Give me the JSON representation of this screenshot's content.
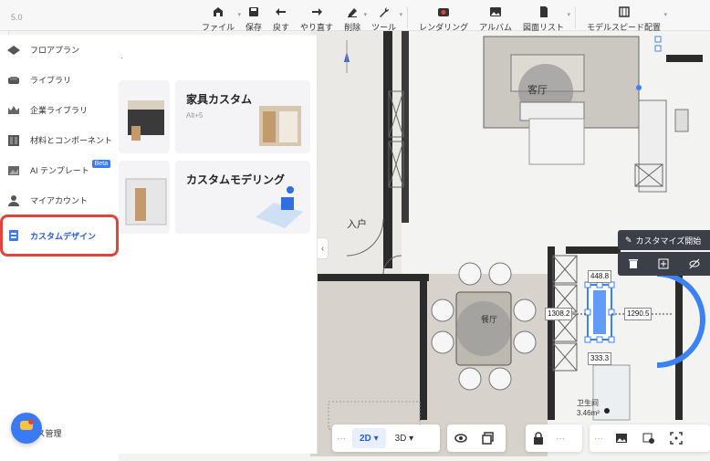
{
  "toolbar": {
    "file": "ファイル",
    "save": "保存",
    "undo": "戻す",
    "redo": "やり直す",
    "delete": "削除",
    "tools": "ツール",
    "render": "レンダリング",
    "album": "アルバム",
    "drawing_list": "図面リスト",
    "model_speed": "モデルスピード配置"
  },
  "ruler": {
    "top_value": "5.0"
  },
  "side_menu": {
    "items": [
      {
        "label": "フロアプラン",
        "icon": "floorplan-icon"
      },
      {
        "label": "ライブラリ",
        "icon": "sofa-icon"
      },
      {
        "label": "企業ライブラリ",
        "icon": "crown-icon"
      },
      {
        "label": "材料とコンポーネント",
        "icon": "materials-icon"
      },
      {
        "label": "AI テンプレート",
        "icon": "ai-template-icon",
        "badge": "Beta"
      },
      {
        "label": "マイアカウント",
        "icon": "user-icon"
      },
      {
        "label": "カスタムデザイン",
        "icon": "custom-design-icon",
        "active": true
      }
    ],
    "bottom_label": "ース管理"
  },
  "panel": {
    "hint": ".",
    "cards": [
      {
        "title": "",
        "subtitle": ""
      },
      {
        "title": "家具カスタム",
        "subtitle": "Alt+5"
      },
      {
        "title": "",
        "subtitle": ""
      },
      {
        "title": "カスタムモデリング",
        "subtitle": ""
      }
    ]
  },
  "plan": {
    "living_room": "客厅",
    "entrance": "入户",
    "dining_room": "餐厅",
    "bathroom": "卫生间",
    "bathroom_area": "3.46m²",
    "dim_top": "448.8",
    "dim_left": "1308.2",
    "dim_right": "1290.5",
    "dim_bottom": "333.3"
  },
  "custom_strip": {
    "start_label": "カスタマイズ開始"
  },
  "bottom_bar": {
    "mode_2d": "2D",
    "mode_3d": "3D"
  },
  "colors": {
    "accent": "#2a5bd7",
    "highlight_border": "#e0443a",
    "dark_panel": "#3b3f48"
  }
}
